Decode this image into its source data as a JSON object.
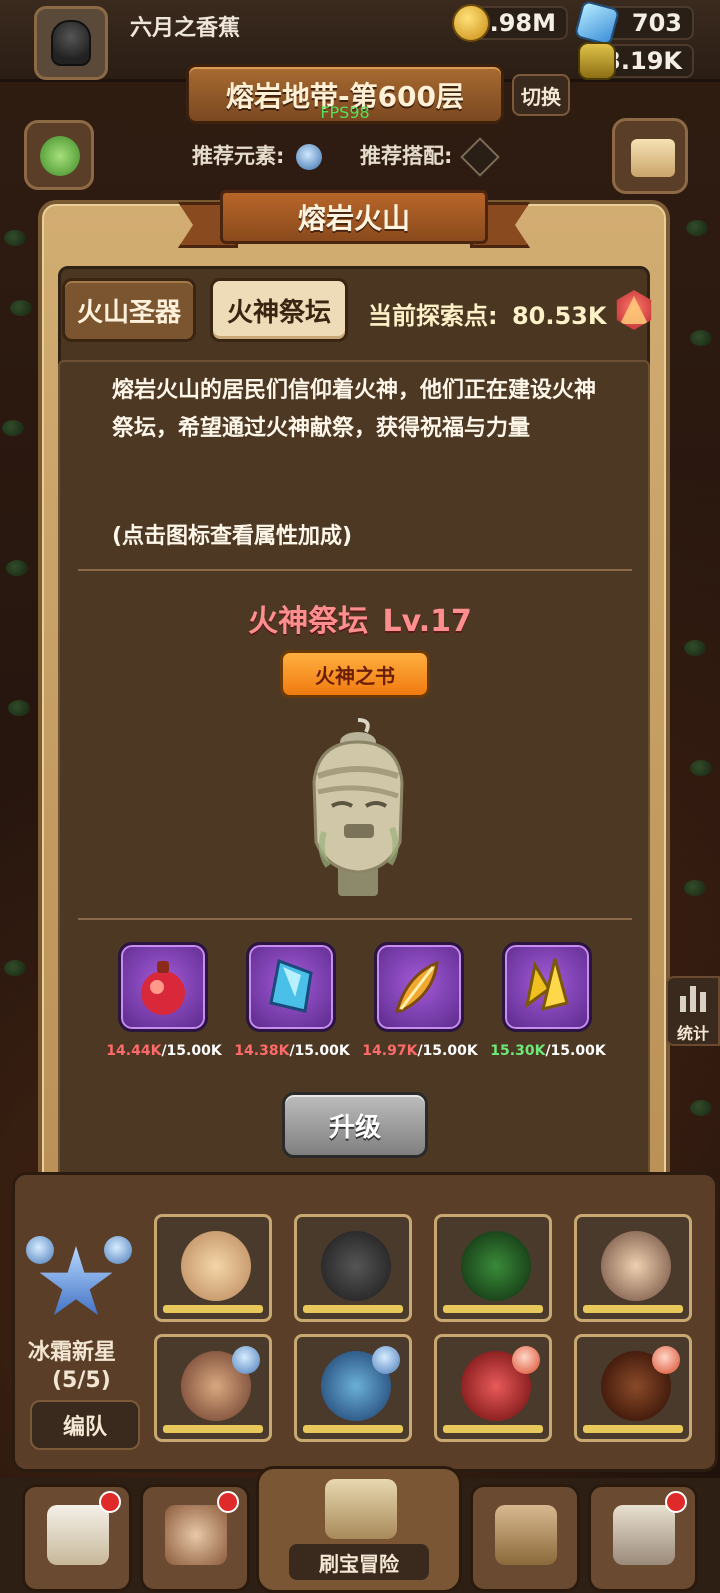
{
  "hud": {
    "player_name": "六月之香蕉",
    "gold": "1.98M",
    "gems": "703",
    "potion": "3.19K",
    "stage_title": "熔岩地带-第600层",
    "fps": "FPS98",
    "switch_label": "切换",
    "recommend_element_label": "推荐元素:",
    "recommend_combo_label": "推荐搭配:"
  },
  "modal": {
    "title": "熔岩火山",
    "tabs": [
      {
        "label": "火山圣器",
        "active": false
      },
      {
        "label": "火神祭坛",
        "active": true
      }
    ],
    "explore_label": "当前探索点:",
    "explore_value": "80.53K",
    "description": "熔岩火山的居民们信仰着火神，他们正在建设火神祭坛，希望通过火神献祭，获得祝福与力量",
    "hint": "(点击图标查看属性加成)",
    "altar_title": "火神祭坛",
    "altar_level": "Lv.17",
    "book_button": "火神之书",
    "materials": [
      {
        "icon": "red-potion-icon",
        "have": "14.44K",
        "need": "/15.00K",
        "enough": false
      },
      {
        "icon": "blue-crystal-icon",
        "have": "14.38K",
        "need": "/15.00K",
        "enough": false
      },
      {
        "icon": "golden-feather-icon",
        "have": "14.97K",
        "need": "/15.00K",
        "enough": false
      },
      {
        "icon": "gold-crystal-icon",
        "have": "15.30K",
        "need": "/15.00K",
        "enough": true
      }
    ],
    "upgrade_button": "升级"
  },
  "team": {
    "formation_name": "冰霜新星",
    "formation_count": "(5/5)",
    "team_button": "编队"
  },
  "side": {
    "stats_label": "统计"
  },
  "nav": {
    "center_label": "刷宝冒险"
  },
  "colors": {
    "insufficient": "#ff6a6a",
    "sufficient": "#6ee878",
    "altar_title": "#ff8f8f",
    "book_button": "#f07a10"
  }
}
